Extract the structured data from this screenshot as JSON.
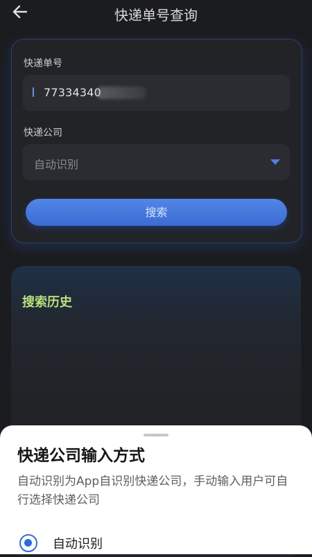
{
  "header": {
    "title": "快递单号查询",
    "back_icon": "arrow-left-icon"
  },
  "query_form": {
    "tracking_label": "快递单号",
    "tracking_value": "77334340",
    "company_label": "快递公司",
    "company_selected": "自动识别",
    "search_button": "搜索"
  },
  "history": {
    "title": "搜索历史"
  },
  "sheet": {
    "title": "快递公司输入方式",
    "description": "自动识别为App自识别快递公司，手动输入用户可自行选择快递公司",
    "options": [
      {
        "label": "自动识别",
        "selected": true
      }
    ]
  },
  "colors": {
    "accent": "#3b6bd4",
    "history_title": "#b8e07e",
    "background": "#1b1c1f"
  }
}
